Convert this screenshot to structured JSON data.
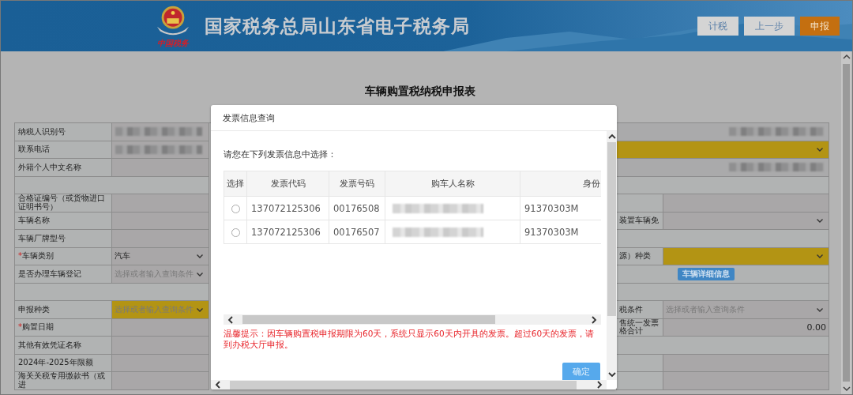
{
  "header": {
    "title": "国家税务总局山东省电子税务局",
    "logo_caption": "中国税务",
    "buttons": [
      {
        "label": "计税",
        "kind": "plain"
      },
      {
        "label": "上一步",
        "kind": "plain"
      },
      {
        "label": "申报",
        "kind": "primary"
      }
    ]
  },
  "form": {
    "title": "车辆购置税纳税申报表",
    "left_rows": [
      {
        "kind": "blurred",
        "label": "纳税人识别号"
      },
      {
        "kind": "blurred",
        "label": "联系电话"
      },
      {
        "kind": "blank",
        "label": "外籍个人中文名称"
      },
      {
        "kind": "empty"
      },
      {
        "kind": "blank",
        "label": "合格证编号（或货物进口证明书号）"
      },
      {
        "kind": "blank",
        "label": "车辆名称"
      },
      {
        "kind": "blank",
        "label": "车辆厂牌型号"
      },
      {
        "kind": "select",
        "marker": "*",
        "label": "车辆类别",
        "value": "汽车",
        "highlighted": false
      },
      {
        "kind": "select",
        "label": "是否办理车辆登记",
        "placeholder": "选择或者输入查询条件",
        "highlighted": false
      },
      {
        "kind": "empty"
      },
      {
        "kind": "select",
        "label": "申报种类",
        "placeholder": "选择或者输入查询条件",
        "highlighted": true
      },
      {
        "kind": "blank",
        "marker": "*",
        "label": "购置日期"
      },
      {
        "kind": "blank",
        "label": "其他有效凭证名称"
      },
      {
        "kind": "blank",
        "label": "2024年-2025年限额"
      },
      {
        "kind": "blank",
        "label": "海关关税专用缴款书（或进"
      }
    ],
    "right_rows": [
      {
        "kind": "blurred"
      },
      {
        "kind": "wide_select",
        "highlighted": true
      },
      {
        "kind": "blurred"
      },
      {
        "kind": "empty"
      },
      {
        "kind": "blank"
      },
      {
        "kind": "select",
        "label": "装置车辆免",
        "highlighted": false
      },
      {
        "kind": "empty"
      },
      {
        "kind": "select",
        "label": "源）种类",
        "highlighted": true
      },
      {
        "kind": "button",
        "label": "车辆详细信息"
      },
      {
        "kind": "empty"
      },
      {
        "kind": "select",
        "label": "税条件",
        "placeholder": "选择或者输入查询条件",
        "highlighted": false
      },
      {
        "kind": "number",
        "label": "售统一发票格合计",
        "value": "0.00"
      },
      {
        "kind": "empty"
      },
      {
        "kind": "blank"
      },
      {
        "kind": "blank"
      }
    ]
  },
  "dialog": {
    "title": "发票信息查询",
    "prompt": "请您在下列发票信息中选择：",
    "columns": [
      "选择",
      "发票代码",
      "发票号码",
      "购车人名称",
      "身份"
    ],
    "rows": [
      {
        "selected": false,
        "invoice_code": "137072125306",
        "invoice_number": "00176508",
        "id_number": "91370303M"
      },
      {
        "selected": false,
        "invoice_code": "137072125306",
        "invoice_number": "00176507",
        "id_number": "91370303M"
      }
    ],
    "notice": "温馨提示：因车辆购置税申报期限为60天，系统只显示60天内开具的发票。超过60天的发票，请到办税大厅申报。",
    "confirm": "确定"
  }
}
